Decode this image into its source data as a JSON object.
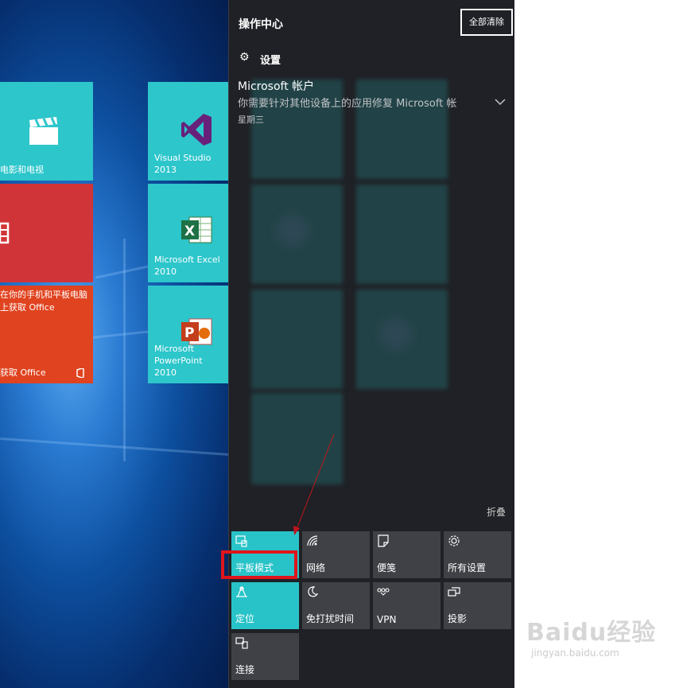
{
  "tiles": {
    "movies": "电影和电视",
    "visual_studio": "Visual Studio 2013",
    "excel": "Microsoft Excel 2010",
    "office_promo": "在你的手机和平板电脑上获取 Office",
    "get_office": "获取 Office",
    "powerpoint": "Microsoft PowerPoint 2010"
  },
  "action_center": {
    "title": "操作中心",
    "clear_all": "全部清除",
    "settings_group": "设置",
    "notification": {
      "title": "Microsoft 帐户",
      "body": "你需要针对其他设备上的应用修复 Microsoft 帐",
      "day": "星期三"
    },
    "collapse": "折叠",
    "quick_actions": [
      {
        "label": "平板模式",
        "icon": "tablet-mode-icon",
        "active": true
      },
      {
        "label": "网络",
        "icon": "network-icon",
        "active": false
      },
      {
        "label": "便笺",
        "icon": "note-icon",
        "active": false
      },
      {
        "label": "所有设置",
        "icon": "gear-icon",
        "active": false
      },
      {
        "label": "定位",
        "icon": "location-icon",
        "active": true
      },
      {
        "label": "免打扰时间",
        "icon": "moon-icon",
        "active": false
      },
      {
        "label": "VPN",
        "icon": "vpn-icon",
        "active": false
      },
      {
        "label": "投影",
        "icon": "project-icon",
        "active": false
      },
      {
        "label": "连接",
        "icon": "connect-icon",
        "active": false
      }
    ]
  },
  "colors": {
    "tile_teal": "#2dc6cb",
    "tile_red": "#d13438",
    "tile_orange": "#e0431f",
    "quick_active": "#28c3c8",
    "highlight": "#e0151c"
  },
  "watermark": {
    "brand": "Baidu经验",
    "url": "jingyan.baidu.com"
  }
}
